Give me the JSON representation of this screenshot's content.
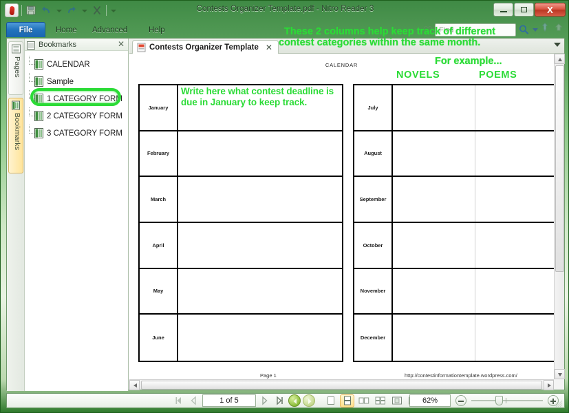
{
  "window": {
    "title": "Contests Organizer Template.pdf - Nitro Reader 3",
    "minimize_label": "Minimize",
    "maximize_label": "Maximize",
    "close_label": "X"
  },
  "quick_access": {
    "logo": "nitro-logo-icon",
    "items": [
      {
        "name": "save-icon",
        "label": "Save"
      },
      {
        "name": "undo-icon",
        "label": "Undo"
      },
      {
        "name": "redo-icon",
        "label": "Redo"
      },
      {
        "name": "close-x-icon",
        "label": "Close"
      }
    ]
  },
  "ribbon": {
    "file_tab": "File",
    "tabs": [
      "Home",
      "Advanced",
      "Help"
    ]
  },
  "find": {
    "placeholder": "Find",
    "value": "",
    "search_icon": "magnifier-icon",
    "dropdown_icon": "chevron-down-icon",
    "heart_icon": "heart-icon"
  },
  "panes": {
    "vertical_tabs": [
      {
        "label": "Pages",
        "icon": "pages-icon",
        "active": false
      },
      {
        "label": "Bookmarks",
        "icon": "bookmarks-icon",
        "active": true
      }
    ]
  },
  "bookmarks": {
    "header": "Bookmarks",
    "close": "✕",
    "items": [
      {
        "label": "CALENDAR",
        "highlighted": true
      },
      {
        "label": "Sample",
        "highlighted": false
      },
      {
        "label": "1 CATEGORY FORM",
        "highlighted": false
      },
      {
        "label": "2 CATEGORY FORM",
        "highlighted": false
      },
      {
        "label": "3 CATEGORY FORM",
        "highlighted": false
      }
    ]
  },
  "document": {
    "tab_label": "Contests Organizer Template",
    "tab_close": "✕",
    "page_heading": "CALENDAR",
    "footer_page": "Page 1",
    "footer_url": "http://contestinformationtemplate.wordpress.com/",
    "left_table": {
      "months": [
        "January",
        "February",
        "March",
        "April",
        "May",
        "June"
      ]
    },
    "right_table": {
      "months": [
        "July",
        "August",
        "September",
        "October",
        "November",
        "December"
      ],
      "column_headers": [
        "NOVELS",
        "POEMS"
      ]
    }
  },
  "annotations": {
    "color": "#2bdb36",
    "top_line1": "These 2 columns help keep track of different",
    "top_line2": "contest categories within the same month.",
    "top_line3": "For example...",
    "january_note": "Write here what contest deadline is due in January to keep track."
  },
  "statusbar": {
    "first_page_label": "First page",
    "prev_page_label": "Previous page",
    "page_value": "1 of 5",
    "next_page_label": "Next page",
    "last_page_label": "Last page",
    "back_label": "Previous view",
    "forward_label": "Next view",
    "view_single": "Single page",
    "view_continuous": "Continuous",
    "view_facing": "Facing pages",
    "view_grid": "Page grid",
    "view_fitpage": "Fit page",
    "view_fitwidth": "Fit width",
    "zoom_value": "62%",
    "zoom_out_label": "Zoom out",
    "zoom_in_label": "Zoom in"
  }
}
